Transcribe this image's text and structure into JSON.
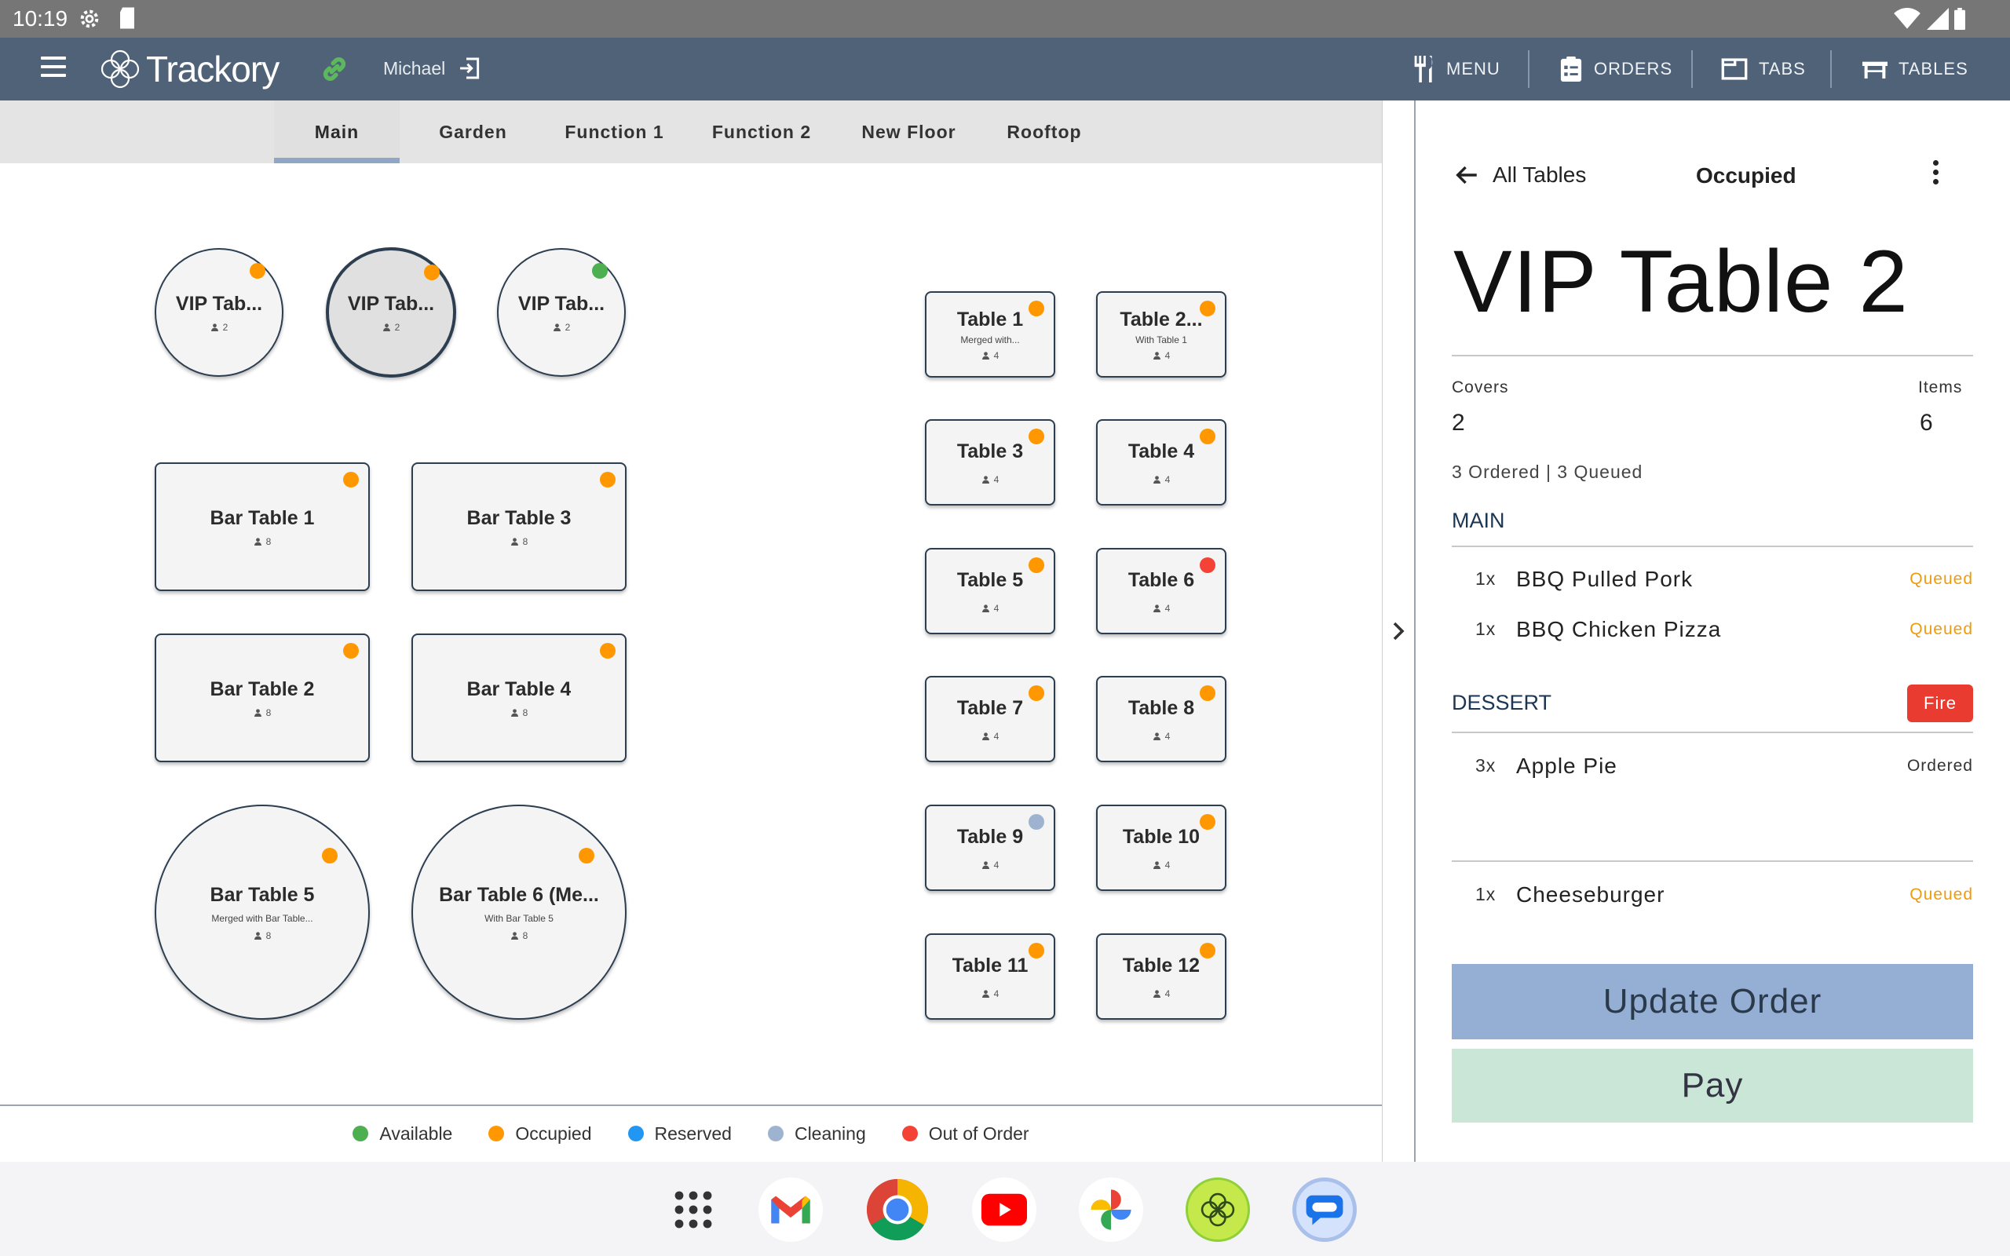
{
  "status_bar": {
    "time": "10:19"
  },
  "app": {
    "name": "Trackory",
    "user": "Michael",
    "nav": {
      "menu": "MENU",
      "orders": "ORDERS",
      "tabs": "TABS",
      "tables": "TABLES"
    }
  },
  "floor_tabs": [
    "Main",
    "Garden",
    "Function 1",
    "Function 2",
    "New Floor",
    "Rooftop"
  ],
  "active_floor_tab": "Main",
  "status_colors": {
    "available": "#4caf50",
    "occupied": "#ff9800",
    "reserved": "#2196f3",
    "cleaning": "#9eb3cf",
    "out_of_order": "#f44336"
  },
  "tables": {
    "vip1": {
      "name": "VIP Tab...",
      "cap": "2",
      "status": "occupied"
    },
    "vip2": {
      "name": "VIP Tab...",
      "cap": "2",
      "status": "occupied"
    },
    "vip3": {
      "name": "VIP Tab...",
      "cap": "2",
      "status": "available"
    },
    "bar1": {
      "name": "Bar Table 1",
      "cap": "8",
      "status": "occupied"
    },
    "bar3": {
      "name": "Bar Table 3",
      "cap": "8",
      "status": "occupied"
    },
    "bar2": {
      "name": "Bar Table 2",
      "cap": "8",
      "status": "occupied"
    },
    "bar4": {
      "name": "Bar Table 4",
      "cap": "8",
      "status": "occupied"
    },
    "bar5": {
      "name": "Bar Table 5",
      "sub": "Merged with Bar Table...",
      "cap": "8",
      "status": "occupied"
    },
    "bar6": {
      "name": "Bar Table 6 (Me...",
      "sub": "With Bar Table 5",
      "cap": "8",
      "status": "occupied"
    },
    "t1": {
      "name": "Table 1",
      "sub": "Merged with...",
      "cap": "4",
      "status": "occupied"
    },
    "t2": {
      "name": "Table 2...",
      "sub": "With Table 1",
      "cap": "4",
      "status": "occupied"
    },
    "t3": {
      "name": "Table 3",
      "cap": "4",
      "status": "occupied"
    },
    "t4": {
      "name": "Table 4",
      "cap": "4",
      "status": "occupied"
    },
    "t5": {
      "name": "Table 5",
      "cap": "4",
      "status": "occupied"
    },
    "t6": {
      "name": "Table 6",
      "cap": "4",
      "status": "out_of_order"
    },
    "t7": {
      "name": "Table 7",
      "cap": "4",
      "status": "occupied"
    },
    "t8": {
      "name": "Table 8",
      "cap": "4",
      "status": "occupied"
    },
    "t9": {
      "name": "Table 9",
      "cap": "4",
      "status": "cleaning"
    },
    "t10": {
      "name": "Table 10",
      "cap": "4",
      "status": "occupied"
    },
    "t11": {
      "name": "Table 11",
      "cap": "4",
      "status": "occupied"
    },
    "t12": {
      "name": "Table 12",
      "cap": "4",
      "status": "occupied"
    }
  },
  "legend": {
    "available": "Available",
    "occupied": "Occupied",
    "reserved": "Reserved",
    "cleaning": "Cleaning",
    "out_of_order": "Out of Order"
  },
  "detail": {
    "back_label": "All Tables",
    "status": "Occupied",
    "title": "VIP Table 2",
    "covers_label": "Covers",
    "covers_value": "2",
    "items_label": "Items",
    "items_value": "6",
    "summary": "3 Ordered | 3 Queued",
    "sections": {
      "main": {
        "title": "MAIN",
        "rows": [
          {
            "qty": "1x",
            "item": "BBQ Pulled Pork",
            "status": "Queued"
          },
          {
            "qty": "1x",
            "item": "BBQ Chicken Pizza",
            "status": "Queued"
          }
        ]
      },
      "dessert": {
        "title": "DESSERT",
        "action": "Fire",
        "rows": [
          {
            "qty": "3x",
            "item": "Apple Pie",
            "status": "Ordered"
          }
        ]
      },
      "other": {
        "rows": [
          {
            "qty": "1x",
            "item": "Cheeseburger",
            "status": "Queued"
          }
        ]
      }
    },
    "update_label": "Update Order",
    "pay_label": "Pay"
  },
  "dock_apps": [
    "app-drawer-icon",
    "gmail-icon",
    "chrome-icon",
    "youtube-icon",
    "photos-icon",
    "trackory-icon",
    "messages-icon"
  ]
}
